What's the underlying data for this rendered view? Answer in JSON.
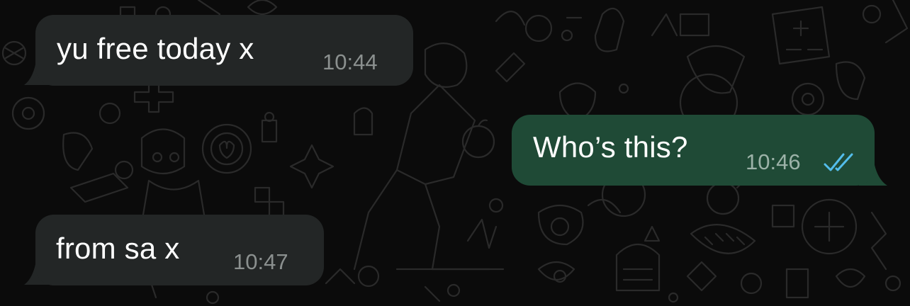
{
  "chat": {
    "messages": [
      {
        "direction": "incoming",
        "text": "yu free today x",
        "time": "10:44"
      },
      {
        "direction": "outgoing",
        "text": "Who’s this?",
        "time": "10:46",
        "status_icon": "double-check-read-icon"
      },
      {
        "direction": "incoming",
        "text": "from sa x",
        "time": "10:47"
      }
    ]
  },
  "colors": {
    "background": "#0b0b0b",
    "incoming_bubble": "#232626",
    "outgoing_bubble": "#1f4a36",
    "read_ticks": "#53bdeb",
    "timestamp": "#8b908f"
  }
}
